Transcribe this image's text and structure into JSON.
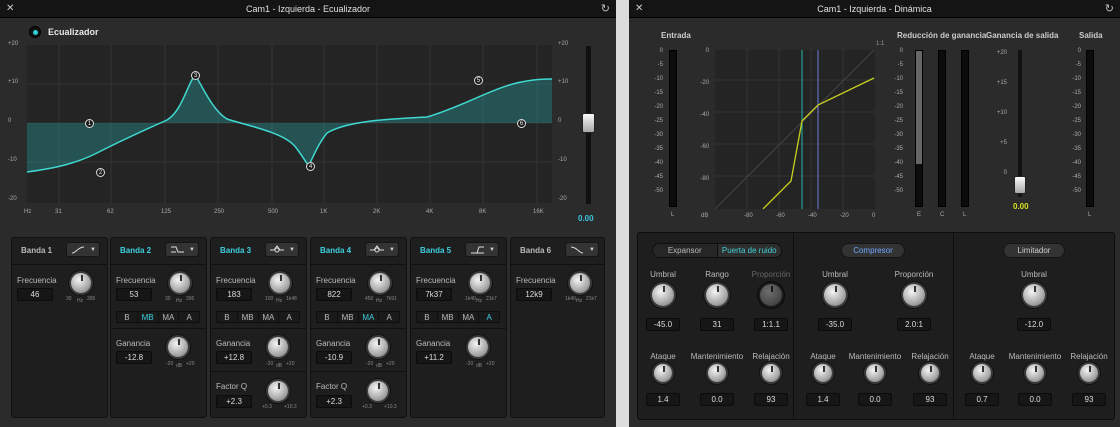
{
  "eq": {
    "title": "Cam1  - Izquierda - Ecualizador",
    "toggle_label": "Ecualizador",
    "left_db_ticks": [
      "+20",
      "+10",
      "0",
      "-10",
      "-20"
    ],
    "right_db_ticks": [
      "+20",
      "+10",
      "0",
      "-10",
      "-20"
    ],
    "freq_ticks": [
      "Hz",
      "31",
      "62",
      "125",
      "250",
      "500",
      "1K",
      "2K",
      "4K",
      "8K",
      "16K"
    ],
    "fader_value": "0.00",
    "markers": [
      "1",
      "2",
      "3",
      "4",
      "5",
      "6"
    ],
    "bands": [
      {
        "name": "Banda 1",
        "freq_label": "Frecuencia",
        "freq": "46",
        "range_lo": "30",
        "unit": "Hz",
        "range_hi": "395"
      },
      {
        "name": "Banda 2",
        "freq_label": "Frecuencia",
        "freq": "53",
        "range_lo": "30",
        "unit": "Hz",
        "range_hi": "395",
        "seg": [
          "B",
          "MB",
          "MA",
          "A"
        ],
        "gain_label": "Ganancia",
        "gain": "-12.8",
        "g_lo": "-20",
        "g_unit": "dB",
        "g_hi": "+20"
      },
      {
        "name": "Banda 3",
        "freq_label": "Frecuencia",
        "freq": "183",
        "range_lo": "100",
        "unit": "Hz",
        "range_hi": "1k48",
        "seg": [
          "B",
          "MB",
          "MA",
          "A"
        ],
        "gain_label": "Ganancia",
        "gain": "+12.8",
        "g_lo": "-20",
        "g_unit": "dB",
        "g_hi": "+20",
        "q_label": "Factor Q",
        "q": "+2.3",
        "q_lo": "+0.3",
        "q_hi": "+10.3"
      },
      {
        "name": "Banda 4",
        "freq_label": "Frecuencia",
        "freq": "822",
        "range_lo": "450",
        "unit": "Hz",
        "range_hi": "7k91",
        "seg": [
          "B",
          "MB",
          "MA",
          "A"
        ],
        "gain_label": "Ganancia",
        "gain": "-10.9",
        "g_lo": "-20",
        "g_unit": "dB",
        "g_hi": "+20",
        "q_label": "Factor Q",
        "q": "+2.3",
        "q_lo": "+0.3",
        "q_hi": "+10.3"
      },
      {
        "name": "Banda 5",
        "freq_label": "Frecuencia",
        "freq": "7k37",
        "range_lo": "1k40",
        "unit": "Hz",
        "range_hi": "21k7",
        "seg": [
          "B",
          "MB",
          "MA",
          "A"
        ],
        "gain_label": "Ganancia",
        "gain": "+11.2",
        "g_lo": "-20",
        "g_unit": "dB",
        "g_hi": "+20"
      },
      {
        "name": "Banda 6",
        "freq_label": "Frecuencia",
        "freq": "12k9",
        "range_lo": "1k40",
        "unit": "Hz",
        "range_hi": "21k7"
      }
    ]
  },
  "dyn": {
    "title": "Cam1  - Izquierda - Dinámica",
    "entrada": "Entrada",
    "reduccion": "Reducción de ganancia",
    "ganancia_salida": "Ganancia de salida",
    "salida": "Salida",
    "meter_ticks": [
      "0",
      "-5",
      "-10",
      "-15",
      "-20",
      "-25",
      "-30",
      "-35",
      "-40",
      "-45",
      "-50"
    ],
    "gain_ticks": [
      "+20",
      "+15",
      "+10",
      "+5",
      "0"
    ],
    "ratio_corner": "1:1",
    "graph_y": [
      "0",
      "-20",
      "-40",
      "-60",
      "-80"
    ],
    "graph_x": [
      "dB",
      "-80",
      "-60",
      "-40",
      "-20",
      "0"
    ],
    "meter_l": "L",
    "meter_e": "E",
    "meter_c": "C",
    "output_value": "0.00",
    "expansor": "Expansor",
    "puerta": "Puerta de ruido",
    "compresor": "Compresor",
    "limitador": "Limitador",
    "umbral": "Umbral",
    "rango": "Rango",
    "proporcion": "Proporción",
    "ataque": "Ataque",
    "mantenimiento": "Mantenimiento",
    "relajacion": "Relajación",
    "exp": {
      "umbral": "-45.0",
      "rango": "31",
      "proporcion": "1:1.1",
      "ataque": "1.4",
      "mant": "0.0",
      "relaj": "93"
    },
    "comp": {
      "umbral": "-35.0",
      "proporcion": "2.0:1",
      "ataque": "1.4",
      "mant": "0.0",
      "relaj": "93"
    },
    "lim": {
      "umbral": "-12.0",
      "ataque": "0.7",
      "mant": "0.0",
      "relaj": "93"
    },
    "db_unit": "dB",
    "ms_unit": "ms"
  }
}
